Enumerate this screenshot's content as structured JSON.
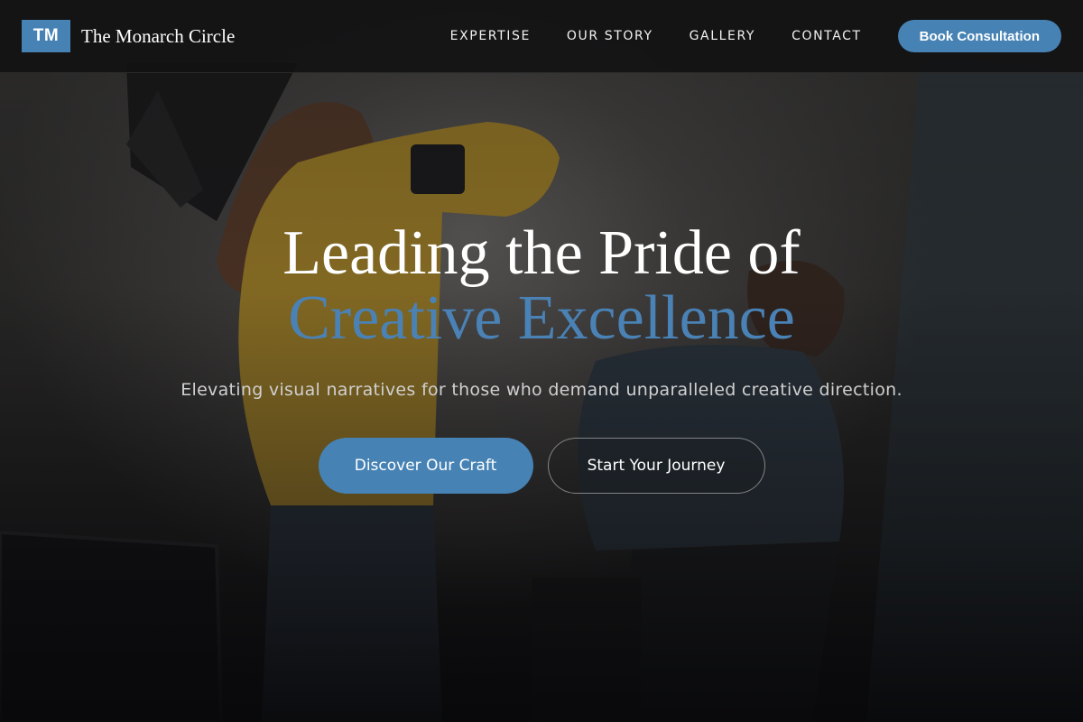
{
  "brand": {
    "mark": "TM",
    "name": "The Monarch Circle"
  },
  "nav": {
    "items": [
      {
        "label": "EXPERTISE"
      },
      {
        "label": "OUR STORY"
      },
      {
        "label": "GALLERY"
      },
      {
        "label": "CONTACT"
      }
    ],
    "cta_label": "Book Consultation"
  },
  "hero": {
    "headline_line1": "Leading the Pride of",
    "headline_line2": "Creative Excellence",
    "subtitle": "Elevating visual narratives for those who demand unparalleled creative direction.",
    "primary_button": "Discover Our Craft",
    "secondary_button": "Start Your Journey"
  },
  "colors": {
    "accent": "#4682b4",
    "navbar_bg": "#121213",
    "page_bg": "#0f1012"
  }
}
